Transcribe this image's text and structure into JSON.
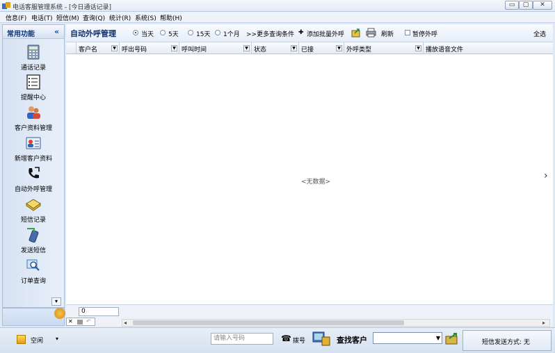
{
  "window": {
    "title": "电话客服管理系统 - [今日通话记录]",
    "controls": {
      "minimize": "▭",
      "maximize": "▢",
      "close": "✕"
    }
  },
  "menu": [
    {
      "label": "信息(F)"
    },
    {
      "label": "电话(T)"
    },
    {
      "label": "短信(M)"
    },
    {
      "label": "查询(Q)"
    },
    {
      "label": "统计(R)"
    },
    {
      "label": "系统(S)"
    },
    {
      "label": "帮助(H)"
    }
  ],
  "sidebar": {
    "title": "常用功能",
    "collapse": "«",
    "items": [
      {
        "label": "通话记录",
        "icon": "calculator-icon"
      },
      {
        "label": "提醒中心",
        "icon": "checklist-icon"
      },
      {
        "label": "客户资料管理",
        "icon": "users-icon"
      },
      {
        "label": "新增客户资料",
        "icon": "contact-card-icon"
      },
      {
        "label": "自动外呼管理",
        "icon": "phone-icon"
      },
      {
        "label": "短信记录",
        "icon": "envelope-icon"
      },
      {
        "label": "发送短信",
        "icon": "mobile-send-icon"
      },
      {
        "label": "订单查询",
        "icon": "magnifier-icon"
      }
    ],
    "scroll_down": "▾"
  },
  "toolbar": {
    "title": "自动外呼管理",
    "ranges": [
      {
        "label": "当天",
        "selected": true
      },
      {
        "label": "5天",
        "selected": false
      },
      {
        "label": "15天",
        "selected": false
      },
      {
        "label": "1个月",
        "selected": false
      }
    ],
    "more_conditions": ">>更多查询条件",
    "add_batch": "添加批量外呼",
    "refresh": "刷新",
    "pause": "暂停外呼",
    "select_all": "全选"
  },
  "grid": {
    "columns": [
      {
        "label": "客户名"
      },
      {
        "label": "呼出号码"
      },
      {
        "label": "呼叫时间"
      },
      {
        "label": "状态"
      },
      {
        "label": "已接"
      },
      {
        "label": "外呼类型"
      },
      {
        "label": "播放语音文件"
      }
    ],
    "empty_text": "<无数据>",
    "page_value": "0"
  },
  "statusbar": {
    "status": "空闲",
    "phone_placeholder": "请输入号码",
    "dial": "拨号",
    "find_customer": "查找客户",
    "find_value": "",
    "sms_mode": "短信发送方式: 无"
  },
  "colors": {
    "accent": "#13367a",
    "sidebar_bg": "#d6e2f3",
    "grid_bg": "#ffffff"
  }
}
